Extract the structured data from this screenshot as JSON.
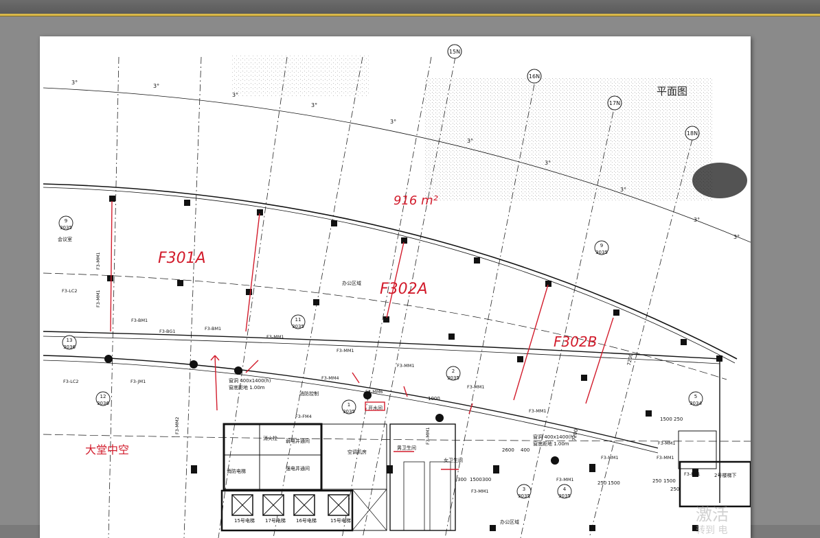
{
  "watermark": {
    "line1": "激活",
    "line2": "转到 电"
  },
  "colors": {
    "red_ink": "#d21c2c",
    "line": "#1a1a1a",
    "window_bar": "#5f5f5f",
    "accent": "#d8b84a"
  },
  "drawing": {
    "gridlines": [
      "15N",
      "16N",
      "17N",
      "18N"
    ],
    "angles": [
      "3°",
      "3°",
      "3°",
      "3°",
      "3°",
      "3°",
      "3°",
      "3°",
      "3°",
      "3°"
    ],
    "room_tags": [
      {
        "num": "9",
        "code": "3035"
      },
      {
        "num": "13",
        "code": "3036"
      },
      {
        "num": "12",
        "code": "3036"
      },
      {
        "num": "11",
        "code": "3035"
      },
      {
        "num": "9",
        "code": "3035"
      },
      {
        "num": "2",
        "code": "3035"
      },
      {
        "num": "1",
        "code": "3035"
      },
      {
        "num": "5",
        "code": "3034"
      },
      {
        "num": "3",
        "code": "3035"
      },
      {
        "num": "4",
        "code": "3035"
      }
    ],
    "room_names": [
      "会议室",
      "办公区域",
      "空调机房",
      "弱电井通间",
      "强电井通间",
      "消防电梯",
      "男卫生间",
      "女卫生间",
      "消火栓",
      "开水间",
      "消防控制",
      "办公区域",
      "2号楼梯下"
    ],
    "door_labels": [
      "F3-MM1",
      "F3-LC2",
      "F3-MM1",
      "F3-BM1",
      "F3-BG1",
      "F3-BM1",
      "F3-MM1",
      "F3-MM1",
      "F3-MM1",
      "F3-MM1",
      "F3-MM1",
      "F3-MM1",
      "F3-MM1",
      "F3-MM1",
      "F3-LC2",
      "F3-JM1",
      "F3-MM2",
      "F3-MM4",
      "F3-FM4",
      "F3-MM6",
      "F3-MM1",
      "F3-MM1",
      "F3-MM1",
      "F3-FM1"
    ],
    "dims": [
      "1000",
      "1500",
      "250",
      "7200",
      "7200",
      "2600",
      "400",
      "300",
      "1500",
      "300",
      "250",
      "250",
      "1500",
      "250",
      "1500"
    ],
    "notes": [
      "窗洞 400x1400(h)",
      "窗底距地 1.00m",
      "窗洞 400x1400(h)",
      "窗底距地 1.00m"
    ],
    "elevators": [
      "15号电梯",
      "17号电梯",
      "16号电梯",
      "15号电梯"
    ],
    "handwriting": {
      "title": "平面图",
      "area": "916 m²",
      "zone_a": "F301A",
      "zone_b": "F302A",
      "zone_c": "F302B",
      "lobby": "大堂中空",
      "marked_room": "开水间"
    }
  }
}
